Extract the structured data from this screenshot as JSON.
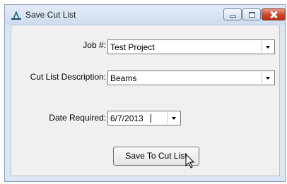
{
  "window": {
    "title": "Save Cut List"
  },
  "form": {
    "job_label": "Job #:",
    "job_value": "Test Project",
    "description_label": "Cut List Description:",
    "description_value": "Beams",
    "date_label": "Date Required:",
    "date_value": "6/7/2013"
  },
  "actions": {
    "save_label": "Save To Cut List"
  },
  "icons": {
    "app": "app-icon",
    "minimize": "minimize-icon",
    "maximize": "maximize-icon",
    "close": "close-icon",
    "dropdown": "chevron-down-icon",
    "cursor": "mouse-pointer-icon"
  },
  "colors": {
    "close_button": "#c9442b",
    "title_bar": "#cfdcee",
    "dialog_background": "#f0f0f0"
  }
}
